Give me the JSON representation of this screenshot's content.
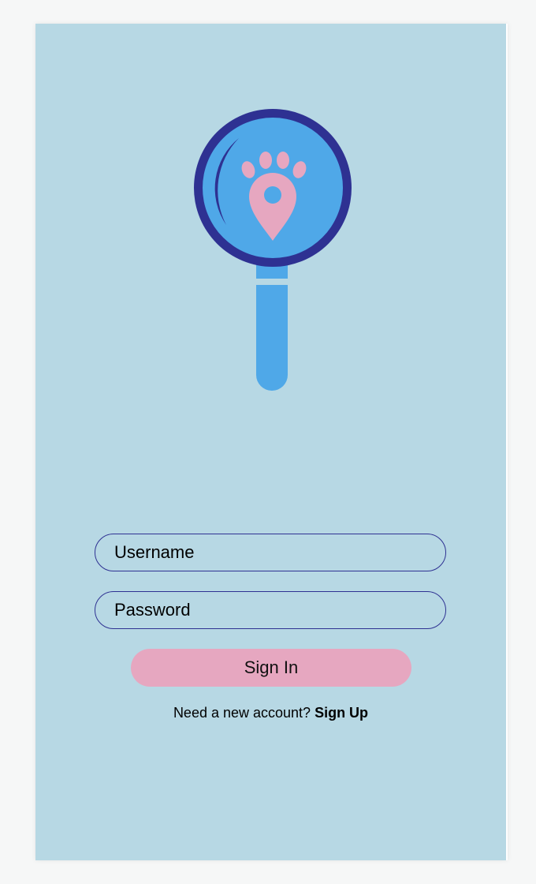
{
  "colors": {
    "background": "#b7d8e4",
    "logo_blue": "#4fa8e8",
    "logo_ring": "#2e3192",
    "logo_pink": "#e6a7c0",
    "button_pink": "#e6a7c0",
    "field_border": "#2e3192"
  },
  "logo": {
    "icon": "magnifier-paw-location-icon"
  },
  "form": {
    "username_placeholder": "Username",
    "password_placeholder": "Password",
    "signin_label": "Sign In"
  },
  "footer": {
    "prompt": "Need a new account?",
    "signup_label": "Sign Up"
  }
}
